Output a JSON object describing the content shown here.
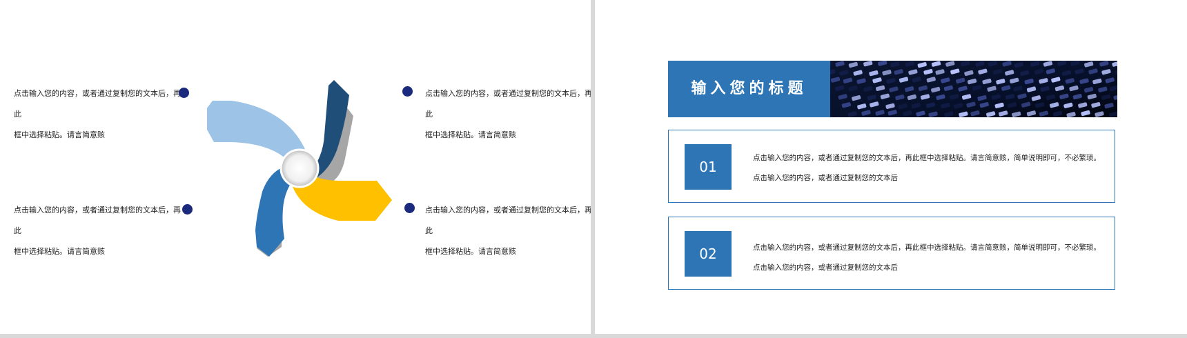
{
  "left_slide": {
    "notes": [
      {
        "line1": "点击输入您的内容，或者通过复制您的文本后，再此",
        "line2": "框中选择粘贴。请言简意赅"
      },
      {
        "line1": "点击输入您的内容，或者通过复制您的文本后，再此",
        "line2": "框中选择粘贴。请言简意赅"
      },
      {
        "line1": "点击输入您的内容，或者通过复制您的文本后，再此",
        "line2": "框中选择粘贴。请言简意赅"
      },
      {
        "line1": "点击输入您的内容，或者通过复制您的文本后，再此",
        "line2": "框中选择粘贴。请言简意赅"
      }
    ],
    "colors": {
      "dot": "#1b2a7c",
      "light_blue": "#9dc3e6",
      "navy": "#1f4e79",
      "mid_blue": "#2e75b6",
      "yellow": "#ffc000",
      "grey": "#a6a6a6"
    }
  },
  "right_slide": {
    "title": "输入您的标题",
    "title_bg": "#2e75b6",
    "cards": [
      {
        "number": "01",
        "line1": "点击输入您的内容，或者通过复制您的文本后，再此框中选择粘贴。请言简意赅，简单说明即可，不必繁琐。",
        "line2": "点击输入您的内容，或者通过复制您的文本后"
      },
      {
        "number": "02",
        "line1": "点击输入您的内容，或者通过复制您的文本后，再此框中选择粘贴。请言简意赅，简单说明即可，不必繁琐。",
        "line2": "点击输入您的内容，或者通过复制您的文本后"
      }
    ]
  }
}
